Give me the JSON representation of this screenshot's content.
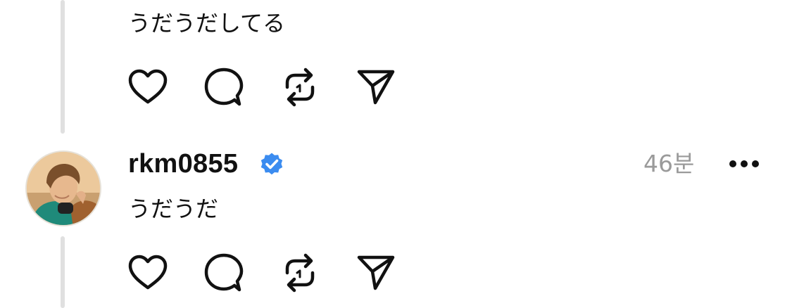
{
  "posts": [
    {
      "text": "うだうだしてる",
      "actions": [
        "heart-icon",
        "comment-icon",
        "repost-icon",
        "share-icon"
      ]
    },
    {
      "username": "rkm0855",
      "verified": true,
      "time": "46분",
      "text": "うだうだ",
      "actions": [
        "heart-icon",
        "comment-icon",
        "repost-icon",
        "share-icon"
      ]
    }
  ],
  "colors": {
    "verified_badge": "#3b8cf0",
    "thread_line": "#e0e0e0",
    "timestamp": "#9a9a9a",
    "avatar_background": "#e9c79a"
  }
}
